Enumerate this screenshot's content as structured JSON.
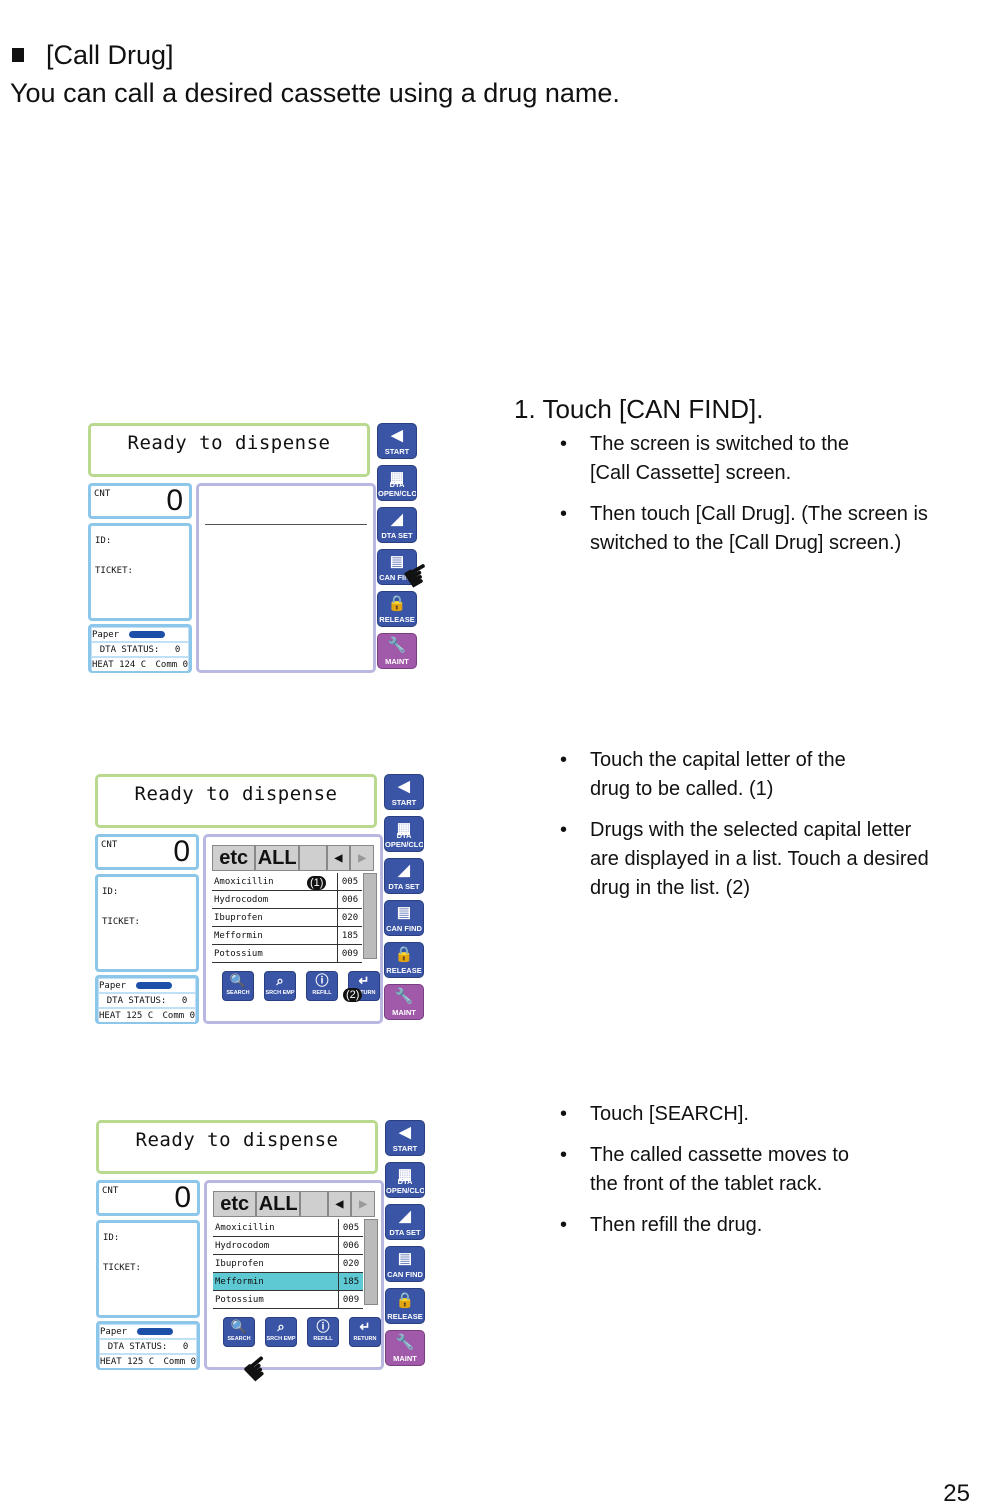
{
  "header": {
    "title": "[Call Drug]",
    "intro": "You can call a desired cassette using a drug name."
  },
  "page_number": "25",
  "device": {
    "message": "Ready to dispense",
    "cnt_label": "CNT",
    "cnt_value": "0",
    "id_label": "ID:",
    "ticket_label": "TICKET:",
    "paper_label": "Paper",
    "dta_status": "DTA STATUS:",
    "dta_status_value": "0",
    "comm": "Comm 0",
    "side_buttons": [
      {
        "label": "START",
        "icon": "◀"
      },
      {
        "label": "DTA OPEN/CLOSE",
        "icon": "▦"
      },
      {
        "label": "DTA SET",
        "icon": "◢"
      },
      {
        "label": "CAN FIND",
        "icon": "▤"
      },
      {
        "label": "RELEASE",
        "icon": "🔒"
      },
      {
        "label": "MAINT",
        "icon": "🔧"
      }
    ],
    "tabs": {
      "etc": "etc",
      "all": "ALL",
      "prev": "◀",
      "next": "▶"
    },
    "drugs": [
      {
        "name": "Amoxicillin",
        "code": "005"
      },
      {
        "name": "Hydrocodom",
        "code": "006"
      },
      {
        "name": "Ibuprofen",
        "code": "020"
      },
      {
        "name": "Mefformin",
        "code": "185"
      },
      {
        "name": "Potossium",
        "code": "009"
      }
    ],
    "bottom_buttons": [
      {
        "label": "SEARCH",
        "icon": "🔍"
      },
      {
        "label": "SRCH EMP",
        "icon": "⌕"
      },
      {
        "label": "REFILL",
        "icon": "ⓘ"
      },
      {
        "label": "RETURN",
        "icon": "↵"
      }
    ]
  },
  "steps": [
    {
      "title": "1. Touch [CAN FIND].",
      "heat": "HEAT 124  C",
      "bullets": [
        "The screen is switched to the [Call Cassette] screen.",
        "Then touch [Call Drug].  (The screen is switched to the [Call Drug] screen.)"
      ]
    },
    {
      "heat": "HEAT 125  C",
      "callout1": "(1)",
      "callout2": "(2)",
      "bullets": [
        "Touch the capital letter of the drug to be called. (1)",
        "Drugs with the selected capital letter are displayed in a list.  Touch a desired drug in the list. (2)"
      ]
    },
    {
      "heat": "HEAT 125  C",
      "bullets": [
        "Touch [SEARCH].",
        "The called cassette moves to the front of the tablet rack.",
        "Then refill the drug."
      ]
    }
  ]
}
